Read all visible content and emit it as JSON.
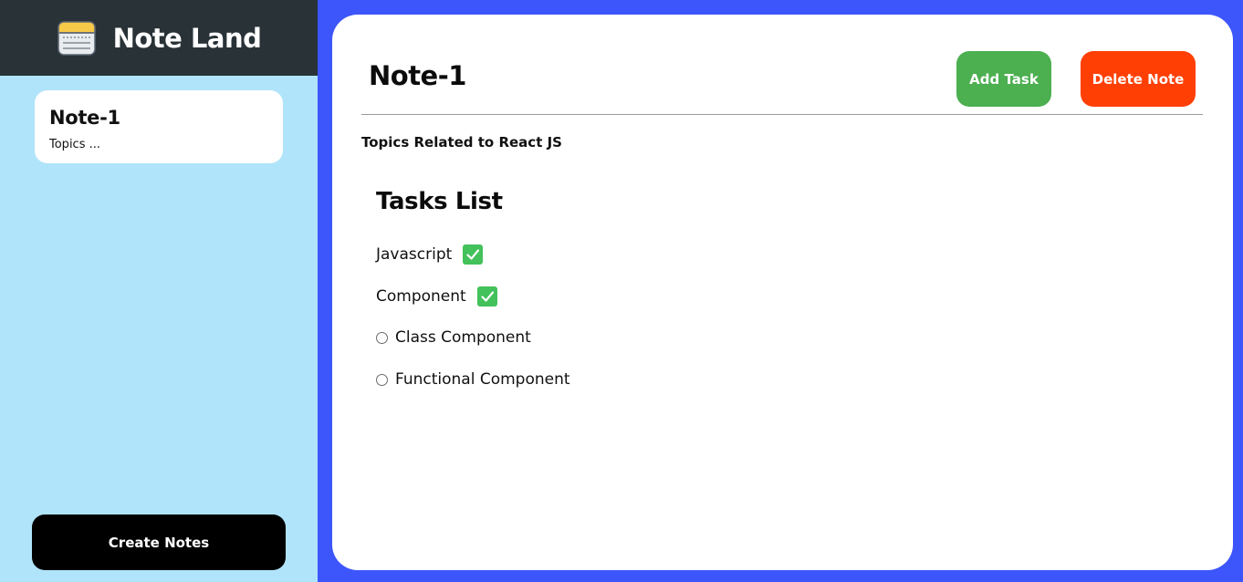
{
  "app": {
    "title": "Note Land",
    "logo_icon": "notepad-icon"
  },
  "sidebar": {
    "background": "#b0e4fa",
    "notes": [
      {
        "title": "Note-1",
        "preview": "Topics ..."
      }
    ],
    "create_label": "Create Notes"
  },
  "note": {
    "title": "Note-1",
    "description": "Topics Related to React JS",
    "add_task_label": "Add Task",
    "delete_label": "Delete Note",
    "tasks_heading": "Tasks List",
    "tasks": [
      {
        "label": "Javascript",
        "done": true
      },
      {
        "label": "Component",
        "done": true
      },
      {
        "label": "Class Component",
        "done": false
      },
      {
        "label": "Functional Component",
        "done": false
      }
    ]
  },
  "colors": {
    "header_bg": "#283237",
    "page_bg": "#3d56fb",
    "add_button": "#4caf50",
    "delete_button": "#ff3f04",
    "check": "#43c15a",
    "create_button": "#000000"
  }
}
